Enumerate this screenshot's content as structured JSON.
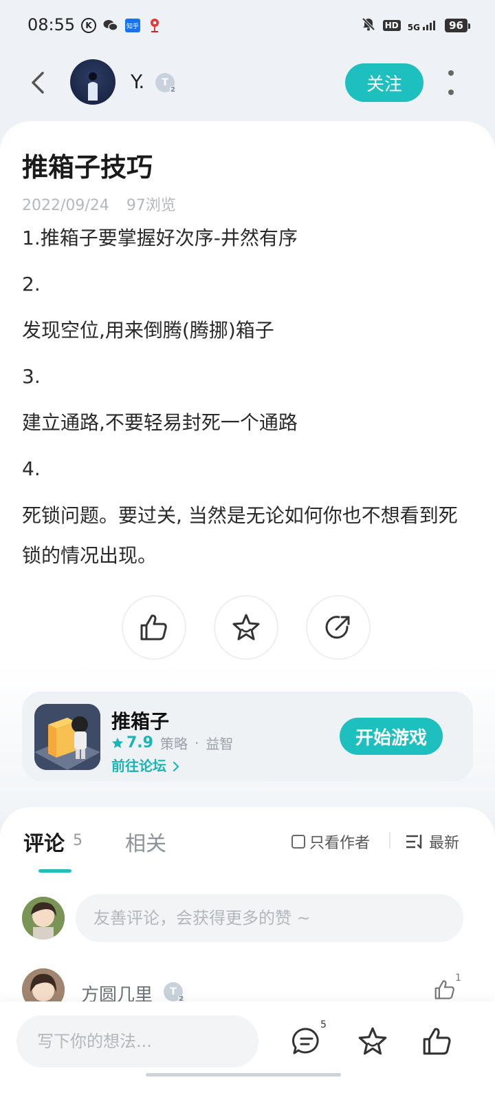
{
  "status_bar": {
    "time": "08:55",
    "left_icons": [
      "k-icon",
      "wechat-icon",
      "zhihu-icon",
      "map-pin-icon"
    ],
    "zhihu_label": "知乎",
    "hd_label": "HD",
    "network_label": "5G",
    "battery": "96"
  },
  "header": {
    "author_name": "Y.",
    "author_badge": "T",
    "author_badge_level": "2",
    "follow_label": "关注"
  },
  "post": {
    "title": "推箱子技巧",
    "date": "2022/09/24",
    "views": "97浏览",
    "paragraphs": [
      "1.推箱子要掌握好次序-井然有序",
      "2.",
      "发现空位,用来倒腾(腾挪)箱子",
      "3.",
      "建立通路,不要轻易封死一个通路",
      "4.",
      "死锁问题。要过关, 当然是无论如何你也不想看到死锁的情况出现。"
    ]
  },
  "game": {
    "name": "推箱子",
    "rating": "7.9",
    "tag1": "策略",
    "separator": "·",
    "tag2": "益智",
    "forum_link": "前往论坛",
    "start_label": "开始游戏"
  },
  "comments": {
    "tab_comments": "评论",
    "count": "5",
    "tab_related": "相关",
    "only_author_label": "只看作者",
    "sort_label": "最新",
    "input_placeholder": "友善评论，会获得更多的赞 ~",
    "items": [
      {
        "name": "方圆几里",
        "badge": "T",
        "badge_level": "2",
        "likes": "1"
      }
    ]
  },
  "bottom_bar": {
    "input_placeholder": "写下你的想法...",
    "comment_count": "5"
  },
  "colors": {
    "accent": "#1ebfbf",
    "background": "#eef1f5",
    "card": "#ffffff"
  }
}
